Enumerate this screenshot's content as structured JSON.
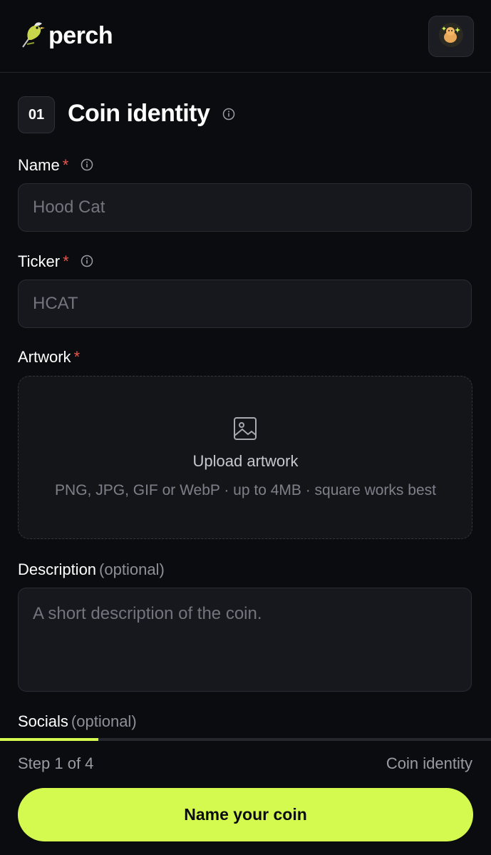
{
  "app": {
    "brand": "perch"
  },
  "step": {
    "number": "01",
    "title": "Coin identity"
  },
  "fields": {
    "name": {
      "label": "Name",
      "required_mark": "*",
      "placeholder": "Hood Cat"
    },
    "ticker": {
      "label": "Ticker",
      "required_mark": "*",
      "placeholder": "HCAT"
    },
    "artwork": {
      "label": "Artwork",
      "required_mark": "*",
      "upload_title": "Upload artwork",
      "upload_hint": "PNG, JPG, GIF or WebP · up to 4MB · square works best"
    },
    "description": {
      "label": "Description",
      "optional": "(optional)",
      "placeholder": "A short description of the coin."
    },
    "socials": {
      "label": "Socials",
      "optional": "(optional)"
    }
  },
  "footer": {
    "progress": 0.2,
    "step_text": "Step 1 of 4",
    "step_name": "Coin identity",
    "cta_label": "Name your coin"
  },
  "colors": {
    "background": "#0b0c0f",
    "accent": "#d5fa4f",
    "required": "#e8574d",
    "muted": "#9a9ca5"
  },
  "icons": [
    "perch-logo-icon",
    "avatar-icon",
    "info-icon",
    "image-icon"
  ]
}
